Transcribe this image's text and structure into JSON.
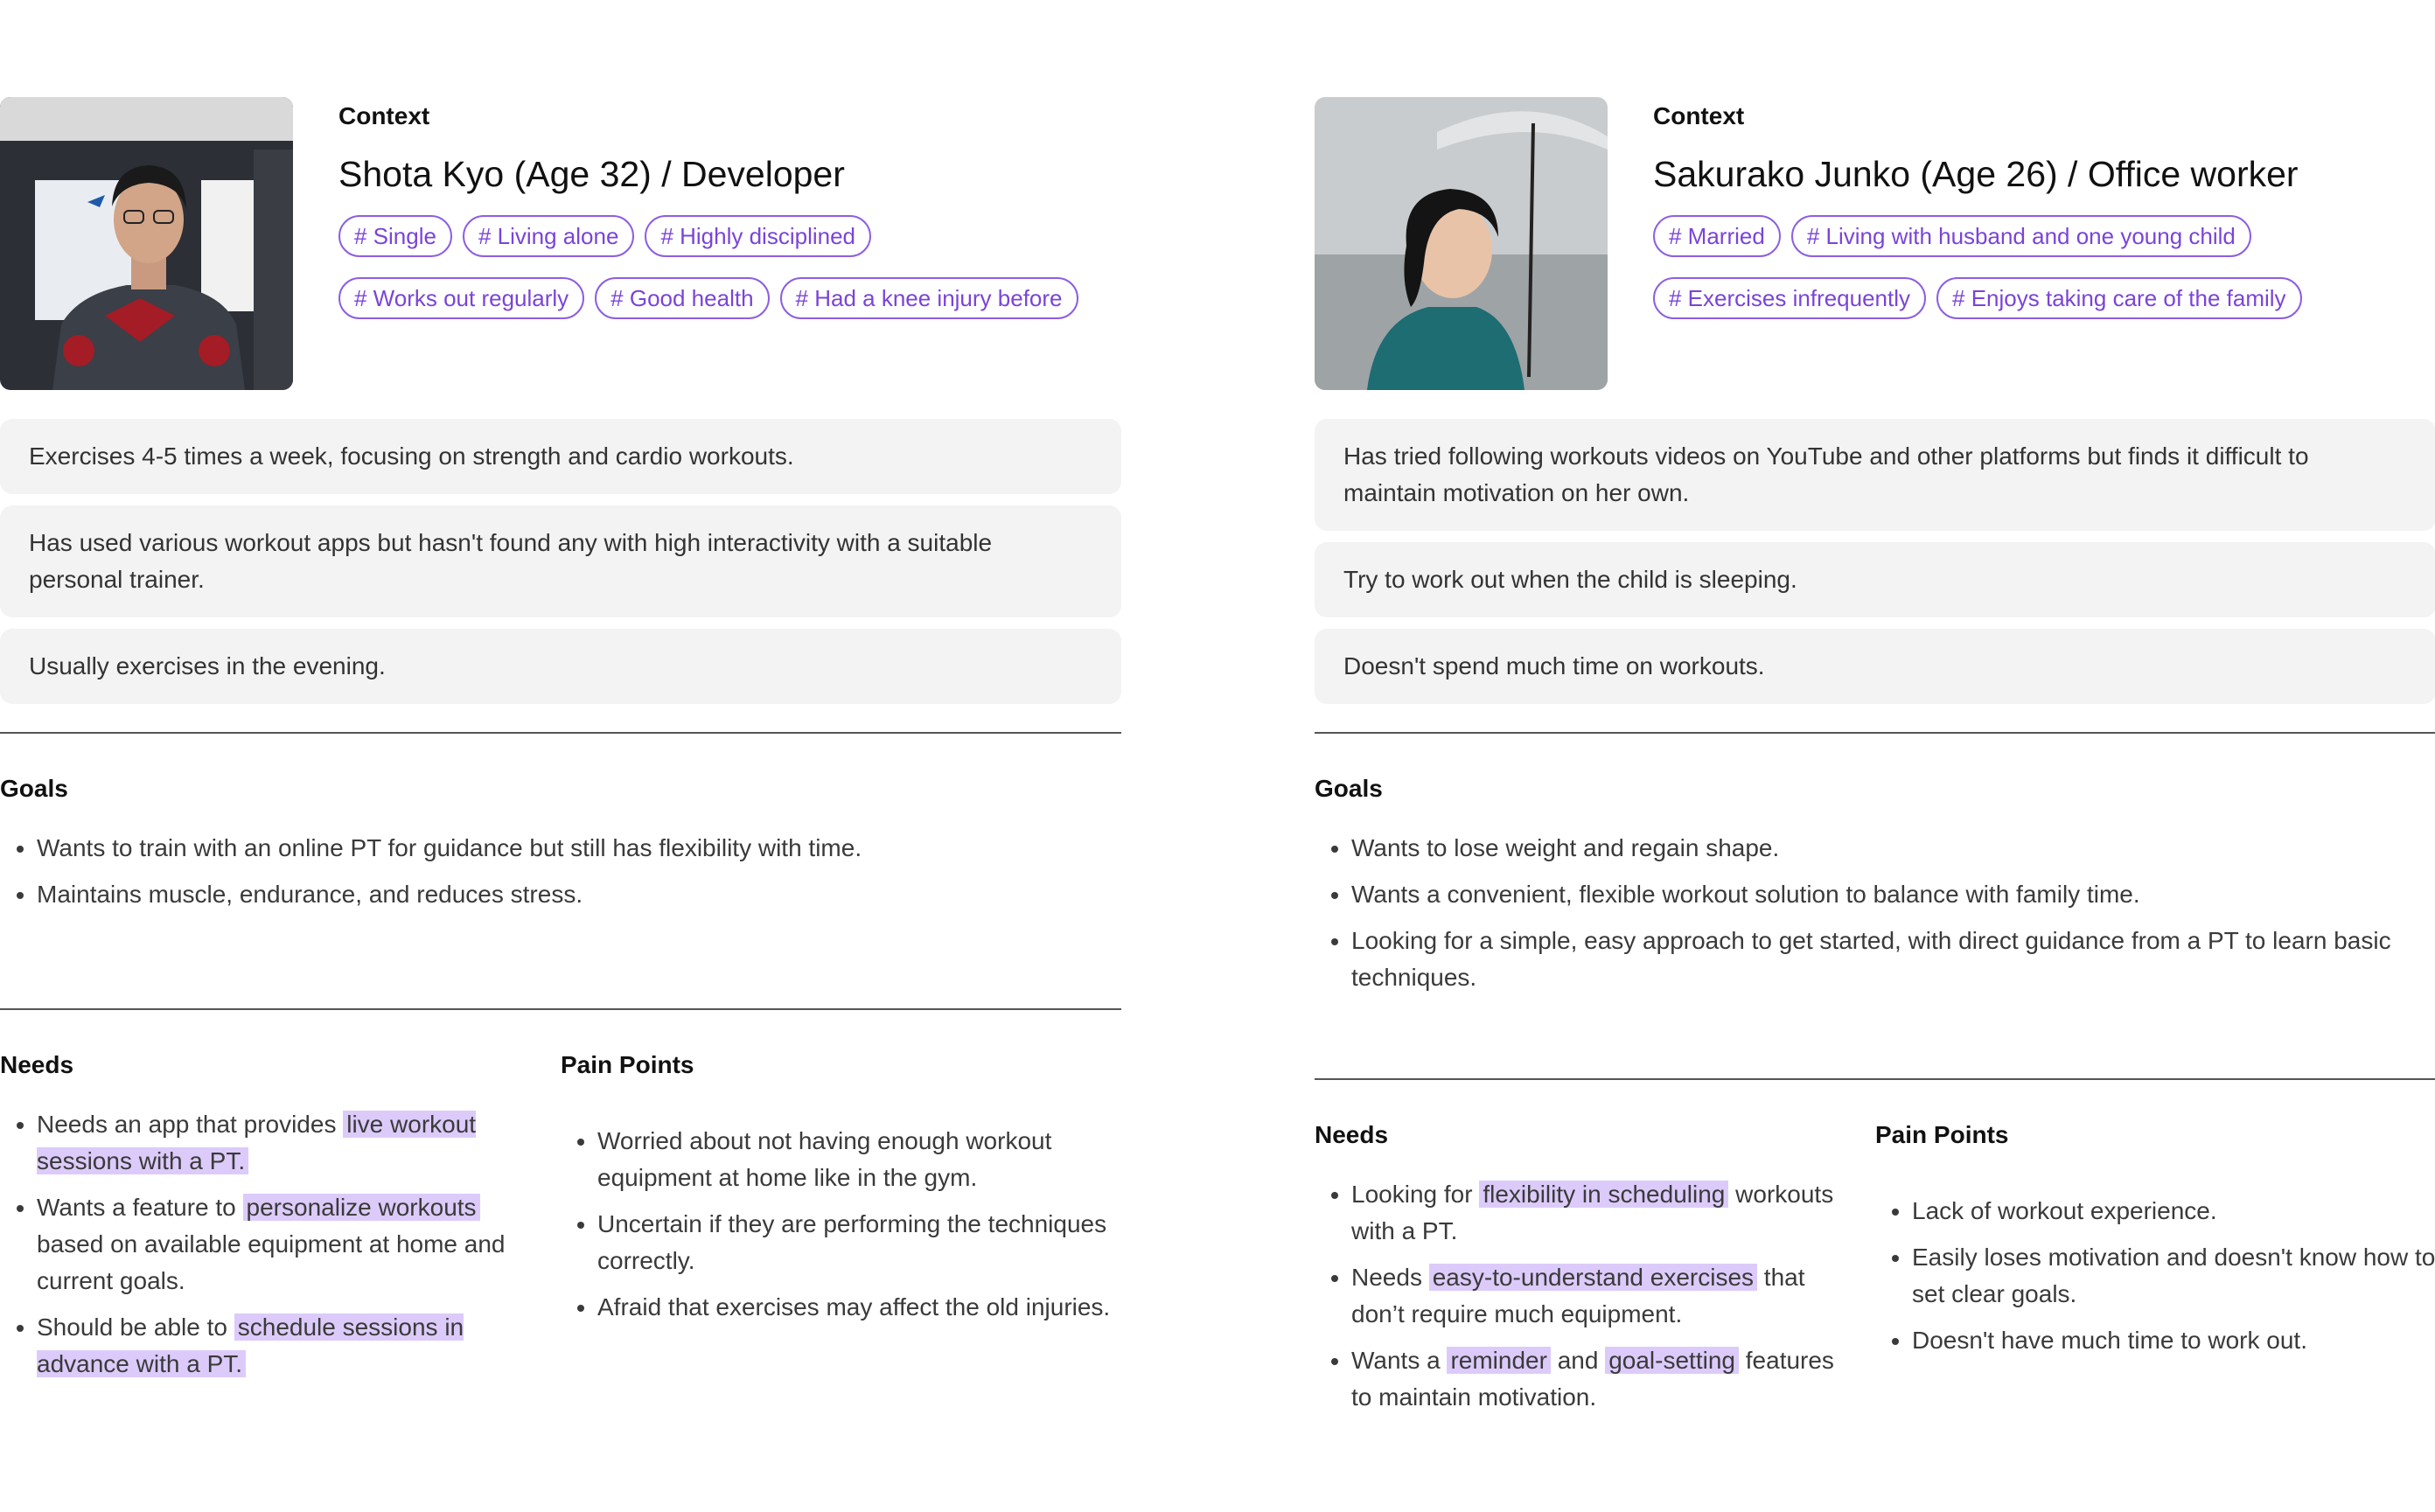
{
  "personas": [
    {
      "context_label": "Context",
      "name": "Shota Kyo (Age 32) / Developer",
      "photo_icon": "man-portrait-photo",
      "tags": [
        "# Single",
        "# Living alone",
        "# Highly disciplined",
        "# Works out regularly",
        "# Good health",
        "# Had a knee injury before"
      ],
      "contexts": [
        "Exercises 4-5 times a week, focusing on strength and cardio workouts.",
        "Has used various workout apps but hasn't found any with high interactivity with a suitable personal trainer.",
        "Usually exercises in the evening."
      ],
      "goals_title": "Goals",
      "goals": [
        "Wants to train with an online PT for guidance but still has flexibility with time.",
        "Maintains muscle, endurance, and reduces stress."
      ],
      "needs_title": "Needs",
      "needs": [
        [
          {
            "t": "Needs an app that provides ",
            "hl": false
          },
          {
            "t": "live workout sessions with a PT.",
            "hl": true
          }
        ],
        [
          {
            "t": "Wants a feature to ",
            "hl": false
          },
          {
            "t": "personalize workouts",
            "hl": true
          },
          {
            "t": " based on available equipment at home and current goals.",
            "hl": false
          }
        ],
        [
          {
            "t": "Should be able to ",
            "hl": false
          },
          {
            "t": "schedule sessions in advance with a PT.",
            "hl": true
          }
        ]
      ],
      "pain_title": "Pain Points",
      "pain_points": [
        "Worried about not having enough workout equipment at home like in the gym.",
        "Uncertain if they are performing the techniques correctly.",
        "Afraid that exercises may affect the old injuries."
      ]
    },
    {
      "context_label": "Context",
      "name": "Sakurako Junko (Age 26) / Office worker",
      "photo_icon": "woman-umbrella-photo",
      "tags": [
        "# Married",
        "# Living with husband and one young child",
        "# Exercises infrequently",
        "# Enjoys taking care of the family"
      ],
      "contexts": [
        "Has tried following workouts videos on YouTube and other platforms but finds it difficult to maintain motivation on her own.",
        "Try to work out when the child is sleeping.",
        "Doesn't spend much time on workouts."
      ],
      "goals_title": "Goals",
      "goals": [
        "Wants to lose weight and regain shape.",
        "Wants a convenient, flexible workout solution to balance with family time.",
        "Looking for a simple, easy approach to get started, with direct guidance from a PT to learn basic techniques."
      ],
      "needs_title": "Needs",
      "needs": [
        [
          {
            "t": "Looking for ",
            "hl": false
          },
          {
            "t": "flexibility in scheduling",
            "hl": true
          },
          {
            "t": " workouts with a PT.",
            "hl": false
          }
        ],
        [
          {
            "t": "Needs ",
            "hl": false
          },
          {
            "t": "easy-to-understand exercises",
            "hl": true
          },
          {
            "t": " that don’t require much equipment.",
            "hl": false
          }
        ],
        [
          {
            "t": "Wants a ",
            "hl": false
          },
          {
            "t": "reminder",
            "hl": true
          },
          {
            "t": " and ",
            "hl": false
          },
          {
            "t": "goal-setting",
            "hl": true
          },
          {
            "t": " features to maintain motivation.",
            "hl": false
          }
        ]
      ],
      "pain_title": "Pain Points",
      "pain_points": [
        "Lack of workout experience.",
        "Easily loses motivation and doesn't know how to set clear goals.",
        "Doesn't have much time to work out."
      ]
    }
  ]
}
